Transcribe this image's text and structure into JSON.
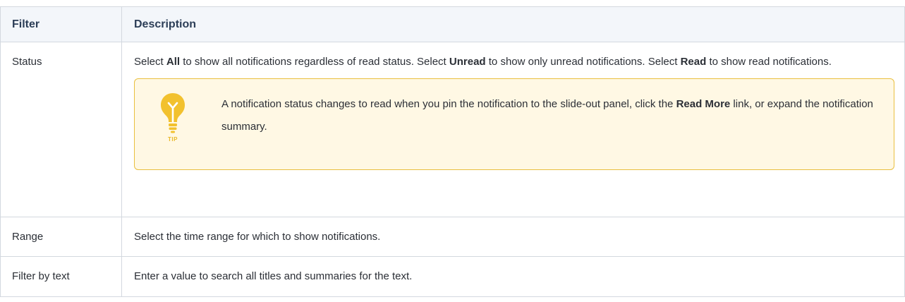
{
  "table": {
    "headers": {
      "filter": "Filter",
      "description": "Description"
    },
    "rows": [
      {
        "filter": "Status",
        "description": {
          "p1_pre": "Select ",
          "p1_all": "All",
          "p1_mid1": " to show all notifications regardless of read status. Select ",
          "p1_unread": "Unread",
          "p1_mid2": " to show only unread notifications. Select ",
          "p1_read": "Read",
          "p1_post": " to show read notifications."
        },
        "tip": {
          "label": "TIP",
          "text_pre": "A notification status changes to read when you pin the notification to the slide-out panel, click the ",
          "text_bold": "Read More",
          "text_post": " link, or expand the notification summary."
        }
      },
      {
        "filter": "Range",
        "description": "Select the time range for which to show notifications."
      },
      {
        "filter": "Filter by text",
        "description": "Enter a value to search all titles and summaries for the text."
      }
    ]
  },
  "colors": {
    "tip_accent": "#f2c12e",
    "tip_background": "#fff8e4",
    "tip_border": "#e9bf3f",
    "header_background": "#f3f6fa"
  },
  "icons": {
    "tip": "lightbulb-icon"
  }
}
